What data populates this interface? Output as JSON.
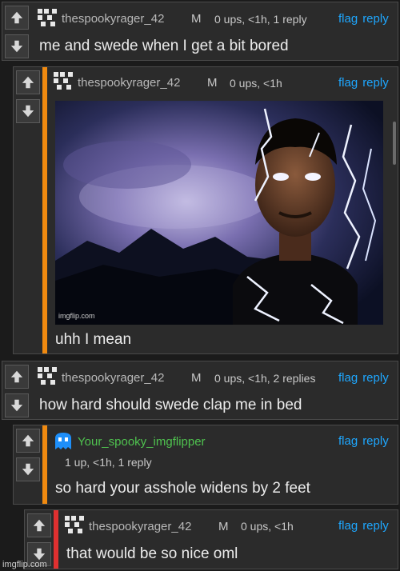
{
  "comments": [
    {
      "username": "thespookyrager_42",
      "gender": "M",
      "meta": "0 ups, <1h, 1 reply",
      "text": "me and swede when I get a bit bored",
      "accent": "#2b2b2b"
    },
    {
      "username": "thespookyrager_42",
      "gender": "M",
      "meta": "0 ups, <1h",
      "text": "uhh I mean",
      "accent": "#f08a10",
      "image_watermark": "imgflip.com"
    },
    {
      "username": "thespookyrager_42",
      "gender": "M",
      "meta": "0 ups, <1h, 2 replies",
      "text": "how hard should swede clap me in bed",
      "accent": "#2b2b2b"
    },
    {
      "username": "Your_spooky_imgflipper",
      "meta": "1 up, <1h, 1 reply",
      "text": "so hard your asshole widens by 2 feet",
      "accent": "#f08a10",
      "username_color": "#4fc24f"
    },
    {
      "username": "thespookyrager_42",
      "gender": "M",
      "meta": "0 ups, <1h",
      "text": "that would be so nice oml",
      "accent": "#e03030"
    }
  ],
  "links": {
    "flag": "flag",
    "reply": "reply"
  },
  "footer_watermark": "imgflip.com"
}
